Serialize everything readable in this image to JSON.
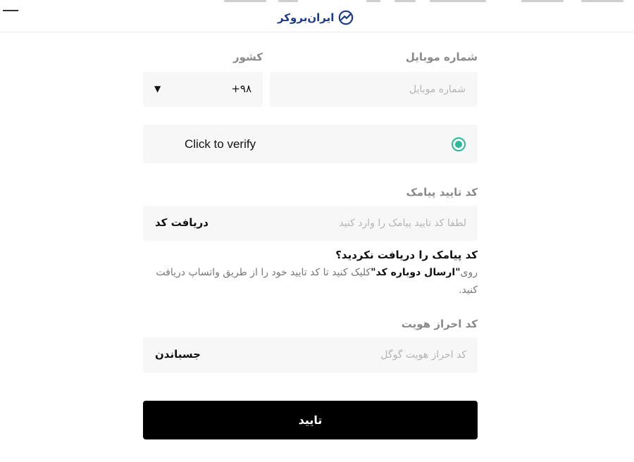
{
  "header": {
    "logo_text": "ایران‌بروکر"
  },
  "form": {
    "mobile": {
      "label": "شماره موبایل",
      "placeholder": "شماره موبایل",
      "value": ""
    },
    "country": {
      "label": "کشور",
      "selected": "+۹۸"
    },
    "captcha": {
      "label": "Click to verify",
      "status_color": "#2bb99a"
    },
    "sms": {
      "label": "کد تایید پیامک",
      "placeholder": "لطفا کد تایید پیامک را وارد کنید",
      "value": "",
      "action": "دریافت کد"
    },
    "help": {
      "title": "کد پیامک را دریافت نکردید؟",
      "before": "روی",
      "link": "\"ارسال دوباره کد\"",
      "after": "کلیک کنید تا کد تایید خود را از طریق واتساپ دریافت کنید."
    },
    "auth": {
      "label": "کد احراز هویت",
      "placeholder": "کد احراز هویت گوگل",
      "value": "",
      "action": "جسباندن"
    },
    "submit_label": "تایید"
  },
  "colors": {
    "brand": "#1a3a8a",
    "accent": "#2bb99a",
    "button_bg": "#000000"
  }
}
